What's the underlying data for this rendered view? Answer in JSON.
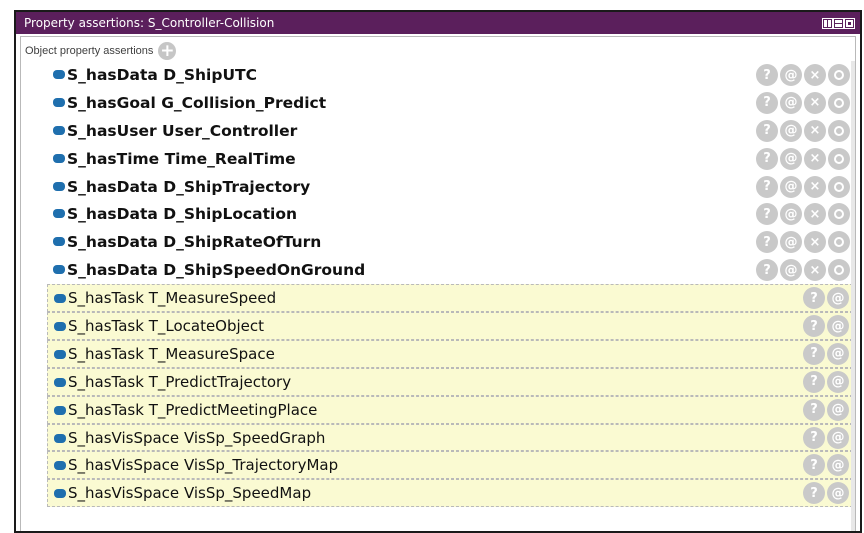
{
  "panel": {
    "title": "Property assertions: S_Controller-Collision",
    "section_label": "Object property assertions",
    "add_label": "+",
    "colors": {
      "titlebar": "#5b1f5c",
      "marker": "#1f6fae",
      "inferred_bg": "#fafad2",
      "action_button": "#c9c9c9"
    }
  },
  "asserted": [
    {
      "property": "S_hasData",
      "value": "D_ShipUTC"
    },
    {
      "property": "S_hasGoal",
      "value": "G_Collision_Predict"
    },
    {
      "property": "S_hasUser",
      "value": "User_Controller"
    },
    {
      "property": "S_hasTime",
      "value": "Time_RealTime"
    },
    {
      "property": "S_hasData",
      "value": "D_ShipTrajectory"
    },
    {
      "property": "S_hasData",
      "value": "D_ShipLocation"
    },
    {
      "property": "S_hasData",
      "value": "D_ShipRateOfTurn"
    },
    {
      "property": "S_hasData",
      "value": "D_ShipSpeedOnGround"
    }
  ],
  "inferred": [
    {
      "property": "S_hasTask",
      "value": "T_MeasureSpeed"
    },
    {
      "property": "S_hasTask",
      "value": "T_LocateObject"
    },
    {
      "property": "S_hasTask",
      "value": "T_MeasureSpace"
    },
    {
      "property": "S_hasTask",
      "value": "T_PredictTrajectory"
    },
    {
      "property": "S_hasTask",
      "value": "T_PredictMeetingPlace"
    },
    {
      "property": "S_hasVisSpace",
      "value": "VisSp_SpeedGraph"
    },
    {
      "property": "S_hasVisSpace",
      "value": "VisSp_TrajectoryMap"
    },
    {
      "property": "S_hasVisSpace",
      "value": "VisSp_SpeedMap"
    }
  ],
  "actions": {
    "explain": "?",
    "annotate": "@",
    "delete": "×"
  }
}
